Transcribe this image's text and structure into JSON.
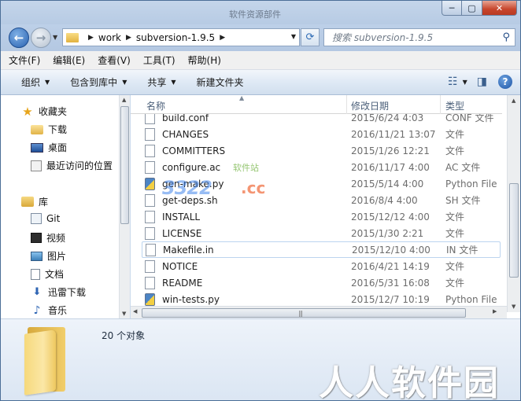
{
  "window": {
    "title": "软件资源部件",
    "controls": {
      "minimize": "─",
      "maximize": "▢",
      "close": "✕"
    }
  },
  "address": {
    "breadcrumb": [
      "work",
      "subversion-1.9.5"
    ],
    "search_placeholder": "搜索 subversion-1.9.5"
  },
  "menu": [
    "文件(F)",
    "编辑(E)",
    "查看(V)",
    "工具(T)",
    "帮助(H)"
  ],
  "toolbar": {
    "organize": "组织",
    "include_in_library": "包含到库中",
    "share": "共享",
    "new_folder": "新建文件夹"
  },
  "nav": {
    "favorites": {
      "label": "收藏夹",
      "items": [
        "下载",
        "桌面",
        "最近访问的位置"
      ]
    },
    "libraries": {
      "label": "库",
      "items": [
        "Git",
        "视频",
        "图片",
        "文档",
        "迅雷下载",
        "音乐"
      ]
    }
  },
  "columns": {
    "name": "名称",
    "date": "修改日期",
    "type": "类型"
  },
  "files": [
    {
      "name": "build.conf",
      "date": "2015/6/24 4:03",
      "type": "CONF 文件",
      "icon": "file"
    },
    {
      "name": "CHANGES",
      "date": "2016/11/21 13:07",
      "type": "文件",
      "icon": "file"
    },
    {
      "name": "COMMITTERS",
      "date": "2015/1/26 12:21",
      "type": "文件",
      "icon": "file"
    },
    {
      "name": "configure.ac",
      "date": "2016/11/17 4:00",
      "type": "AC 文件",
      "icon": "file"
    },
    {
      "name": "gen-make.py",
      "date": "2015/5/14 4:00",
      "type": "Python File",
      "icon": "python"
    },
    {
      "name": "get-deps.sh",
      "date": "2016/8/4 4:00",
      "type": "SH 文件",
      "icon": "file"
    },
    {
      "name": "INSTALL",
      "date": "2015/12/12 4:00",
      "type": "文件",
      "icon": "file"
    },
    {
      "name": "LICENSE",
      "date": "2015/1/30 2:21",
      "type": "文件",
      "icon": "file"
    },
    {
      "name": "Makefile.in",
      "date": "2015/12/10 4:00",
      "type": "IN 文件",
      "icon": "file",
      "selected": true
    },
    {
      "name": "NOTICE",
      "date": "2016/4/21 14:19",
      "type": "文件",
      "icon": "file"
    },
    {
      "name": "README",
      "date": "2016/5/31 16:08",
      "type": "文件",
      "icon": "file"
    },
    {
      "name": "win-tests.py",
      "date": "2015/12/7 10:19",
      "type": "Python File",
      "icon": "python"
    }
  ],
  "details": {
    "count": "20 个对象"
  },
  "watermarks": {
    "brand": "人人软件园",
    "logo_digits": "3322",
    "logo_suffix": ".cc",
    "logo_tag": "软件站"
  }
}
